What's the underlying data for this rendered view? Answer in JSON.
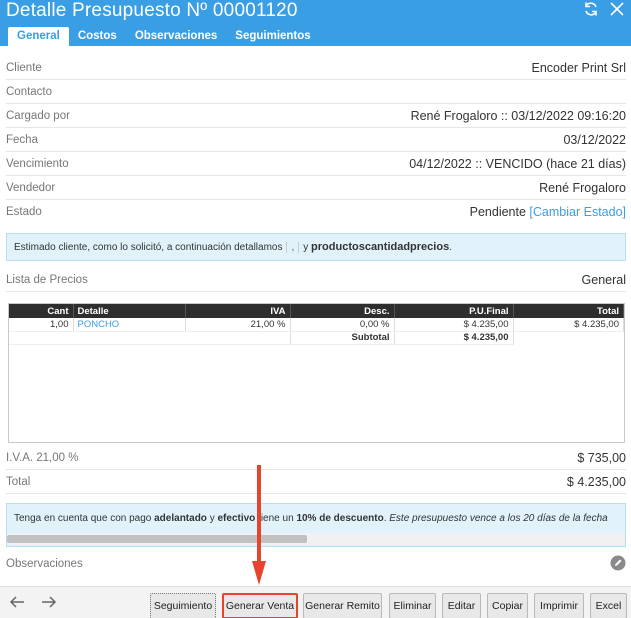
{
  "header": {
    "title": "Detalle Presupuesto Nº 00001120",
    "refresh_icon": "refresh-icon",
    "close_icon": "close-icon"
  },
  "tabs": [
    {
      "label": "General",
      "active": true
    },
    {
      "label": "Costos",
      "active": false
    },
    {
      "label": "Observaciones",
      "active": false
    },
    {
      "label": "Seguimientos",
      "active": false
    }
  ],
  "fields": {
    "cliente": {
      "label": "Cliente",
      "value": "Encoder Print Srl"
    },
    "contacto": {
      "label": "Contacto",
      "value": ""
    },
    "cargado_por": {
      "label": "Cargado por",
      "value": "René Frogaloro :: 03/12/2022 09:16:20"
    },
    "fecha": {
      "label": "Fecha",
      "value": "03/12/2022"
    },
    "vencimiento": {
      "label": "Vencimiento",
      "value": "04/12/2022 :: VENCIDO (hace 21 días)"
    },
    "vendedor": {
      "label": "Vendedor",
      "value": "René Frogaloro"
    },
    "estado": {
      "label": "Estado",
      "value": "Pendiente",
      "link": "[Cambiar Estado]"
    }
  },
  "notice": {
    "prefix": "Estimado cliente, como lo solicitó, a continuación detallamos",
    "sep": ",",
    "mid": "y",
    "bold": "productoscantidadprecios",
    "suffix": "."
  },
  "lista_precios": {
    "label": "Lista de Precios",
    "value": "General"
  },
  "items_table": {
    "headers": [
      "Cant",
      "Detalle",
      "IVA",
      "Desc.",
      "P.U.Final",
      "Total"
    ],
    "rows": [
      {
        "cant": "1,00",
        "detalle": "PONCHO",
        "iva": "21,00 %",
        "desc": "0,00 %",
        "pu": "$ 4.235,00",
        "total": "$ 4.235,00"
      }
    ],
    "subtotal_label": "Subtotal",
    "subtotal_value": "$ 4.235,00"
  },
  "totals": {
    "iva_label": "I.V.A. 21,00 %",
    "iva_value": "$ 735,00",
    "total_label": "Total",
    "total_value": "$ 4.235,00"
  },
  "promo": {
    "t1": "Tenga en cuenta que con pago ",
    "b1": "adelantado",
    "t2": " y ",
    "b2": "efectivo",
    "t3": " tiene un ",
    "b3": "10% de descuento",
    "t4": ". ",
    "i1": "Este presupuesto vence a los 20 días de la fecha"
  },
  "observaciones": {
    "label": "Observaciones",
    "edit_icon": "pencil-icon"
  },
  "footer": {
    "back_icon": "arrow-left-icon",
    "forward_icon": "arrow-right-icon",
    "buttons": [
      "Seguimiento",
      "Generar Venta",
      "Generar Remito",
      "Eliminar",
      "Editar",
      "Copiar",
      "Imprimir",
      "Excel"
    ]
  },
  "colors": {
    "accent": "#3a9ee4",
    "warning": "#e8666b",
    "highlight": "#e8432e"
  }
}
